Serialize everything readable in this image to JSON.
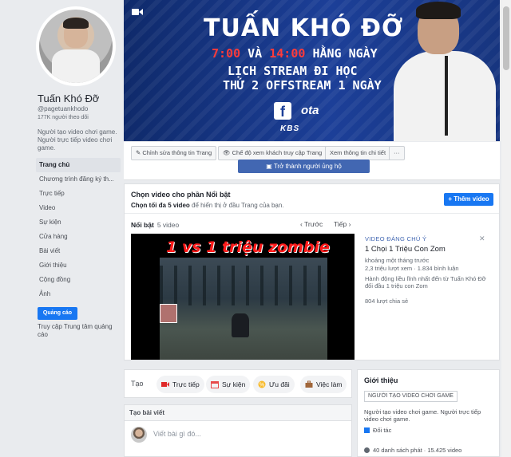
{
  "page": {
    "name": "Tuấn Khó Đỡ",
    "handle": "@pagetuankhodo",
    "followers": "177K người theo dõi",
    "description": "Người tạo video chơi game. Người trực tiếp video chơi game."
  },
  "sidebar": {
    "items": [
      {
        "label": "Trang chủ",
        "active": true
      },
      {
        "label": "Chương trình đăng ký th..."
      },
      {
        "label": "Trực tiếp"
      },
      {
        "label": "Video"
      },
      {
        "label": "Sự kiện"
      },
      {
        "label": "Cửa hàng"
      },
      {
        "label": "Bài viết"
      },
      {
        "label": "Giới thiệu"
      },
      {
        "label": "Cộng đồng"
      },
      {
        "label": "Ảnh"
      }
    ],
    "ads_button": "Quảng cáo",
    "support_link": "Truy cập Trung tâm quảng cáo"
  },
  "cover": {
    "title": "TUẤN KHÓ ĐỠ",
    "time1": "7:00",
    "and": "VÀ",
    "time2": "14:00",
    "daily": "HẰNG NGÀY",
    "line2": "LỊCH STREAM ĐI HỌC",
    "line3": "THỨ 2 OFFSTREAM 1 NGÀY",
    "fb_logo": "f",
    "logo2": "ota",
    "logo3": "KBS"
  },
  "actions": {
    "edit": "Chỉnh sửa thông tin Trang",
    "view_as": "Chế độ xem khách truy cập Trang",
    "details": "Xem thông tin chi tiết",
    "more": "···",
    "become_supporter": "Trở thành người ủng hộ"
  },
  "featured": {
    "title": "Chọn video cho phần Nổi bật",
    "subtitle_bold": "Chọn tối đa 5 video",
    "subtitle_rest": " để hiển thị ở đầu Trang của bạn.",
    "add_button": "+ Thêm video",
    "section_label": "Nổi bật",
    "count": "5 video",
    "prev": "Trước",
    "next": "Tiếp",
    "video_overlay": "1 vs 1 triệu zombie",
    "side_small_title": "VIDEO ĐÁNG CHÚ Ý",
    "side_title": "1 Chọi 1 Triệu Con Zom",
    "side_meta1": "khoảng một tháng trước",
    "side_meta2": "2,3 triệu lượt xem · 1.834 bình luận",
    "side_desc": "Hành động liều lĩnh nhất đến từ Tuấn Khó Đỡ đối đầu 1 triệu con Zom",
    "side_shares": "804 lượt chia sẻ",
    "close": "✕"
  },
  "composer": {
    "label": "Tạo",
    "tabs": [
      "Trực tiếp",
      "Sự kiện",
      "Ưu đãi",
      "Việc làm"
    ]
  },
  "create_post": {
    "header": "Tạo bài viết",
    "placeholder": "Viết bài gì đó..."
  },
  "about": {
    "title": "Giới thiệu",
    "tag": "NGƯỜI TẠO VIDEO CHƠI GAME",
    "desc": "Người tạo video chơi game. Người trực tiếp video chơi game.",
    "partner": "Đối tác",
    "playlists": "40 danh sách phát · 15.425 video"
  },
  "colors": {
    "brand": "#1877f2",
    "cover_bg": "#1c3f98",
    "accent_red": "#ff3b3b"
  }
}
